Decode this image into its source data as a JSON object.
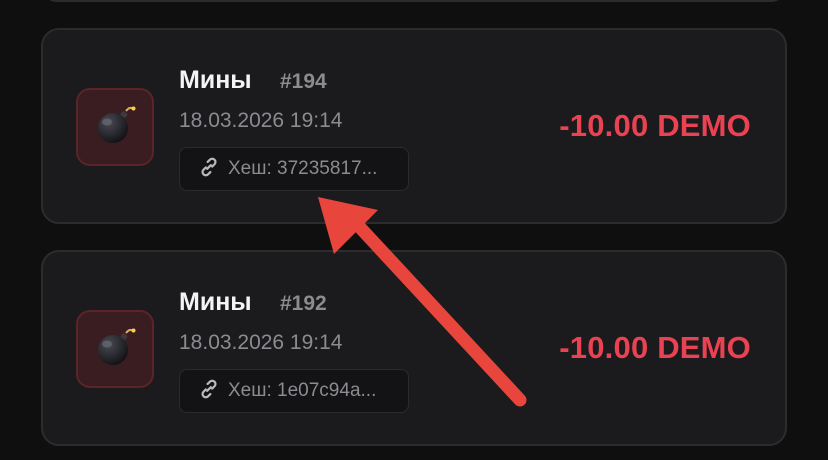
{
  "transactions": [
    {
      "game_name": "Мины",
      "game_id": "#194",
      "datetime": "18.03.2026 19:14",
      "hash": "Хеш: 37235817...",
      "amount": "-10.00 DEMO",
      "icon": "bomb-icon"
    },
    {
      "game_name": "Мины",
      "game_id": "#192",
      "datetime": "18.03.2026 19:14",
      "hash": "Хеш: 1e07c94a...",
      "amount": "-10.00 DEMO",
      "icon": "bomb-icon"
    }
  ],
  "colors": {
    "background": "#0f0f10",
    "card": "#1b1b1d",
    "amount_negative": "#ea4253",
    "annotation_arrow": "#e8463c"
  },
  "annotation": {
    "icon": "arrow-annotation"
  }
}
